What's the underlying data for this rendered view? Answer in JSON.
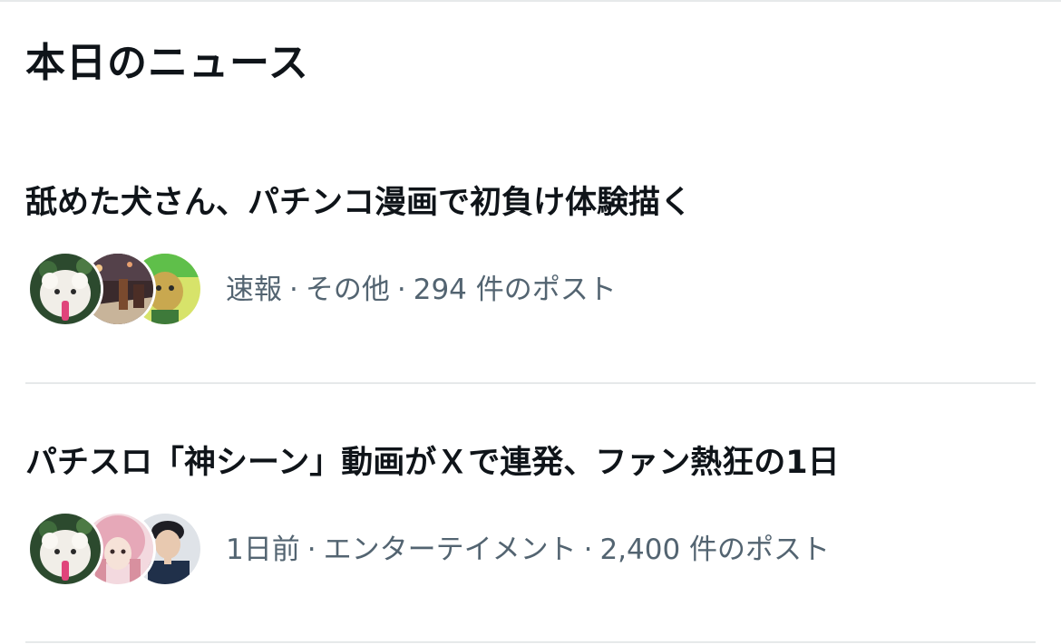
{
  "section": {
    "title": "本日のニュース"
  },
  "news": [
    {
      "headline": "舐めた犬さん、パチンコ漫画で初負け体験描く",
      "time": "速報",
      "category": "その他",
      "posts": "294 件のポスト",
      "separator": "·",
      "avatars": [
        "sheep-plush-avatar",
        "night-street-avatar",
        "green-character-avatar"
      ]
    },
    {
      "headline": "パチスロ「神シーン」動画がＸで連発、ファン熱狂の1日",
      "time": "1日前",
      "category": "エンターテイメント",
      "posts": "2,400 件のポスト",
      "separator": "·",
      "avatars": [
        "sheep-plush-avatar",
        "pink-hair-avatar",
        "man-portrait-avatar"
      ]
    }
  ],
  "colors": {
    "text": "#0f1419",
    "meta": "#536471",
    "divider": "#e6e9ea",
    "background": "#ffffff"
  }
}
